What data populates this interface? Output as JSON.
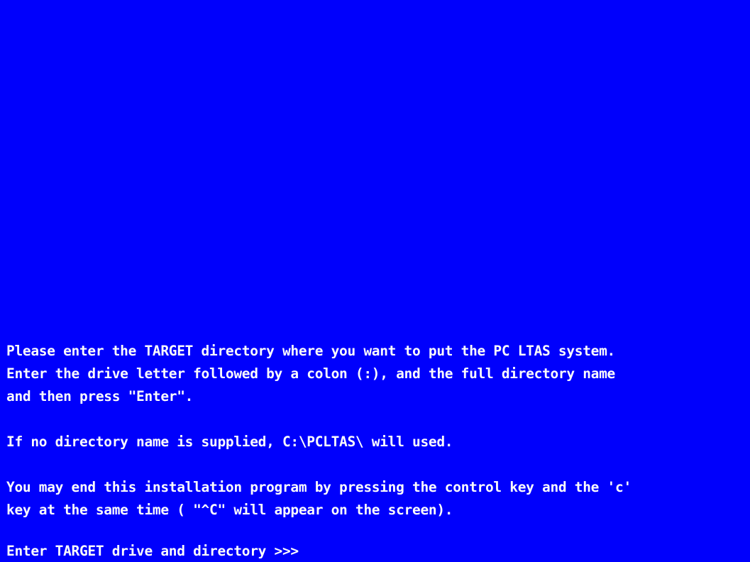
{
  "screen": {
    "background_color": "#0000FC",
    "text_color": "#FCFCFC",
    "lines": [
      "Please enter the TARGET directory where you want to put the PC LTAS system.",
      "Enter the drive letter followed by a colon (:), and the full directory name",
      "and then press \"Enter\".",
      "If no directory name is supplied, C:\\PCLTAS\\ will used.",
      "You may end this installation program by pressing the control key and the 'c'",
      "key at the same time ( \"^C\" will appear on the screen)."
    ],
    "prompt": {
      "label": "Enter TARGET drive and directory >>>",
      "value": ""
    }
  }
}
